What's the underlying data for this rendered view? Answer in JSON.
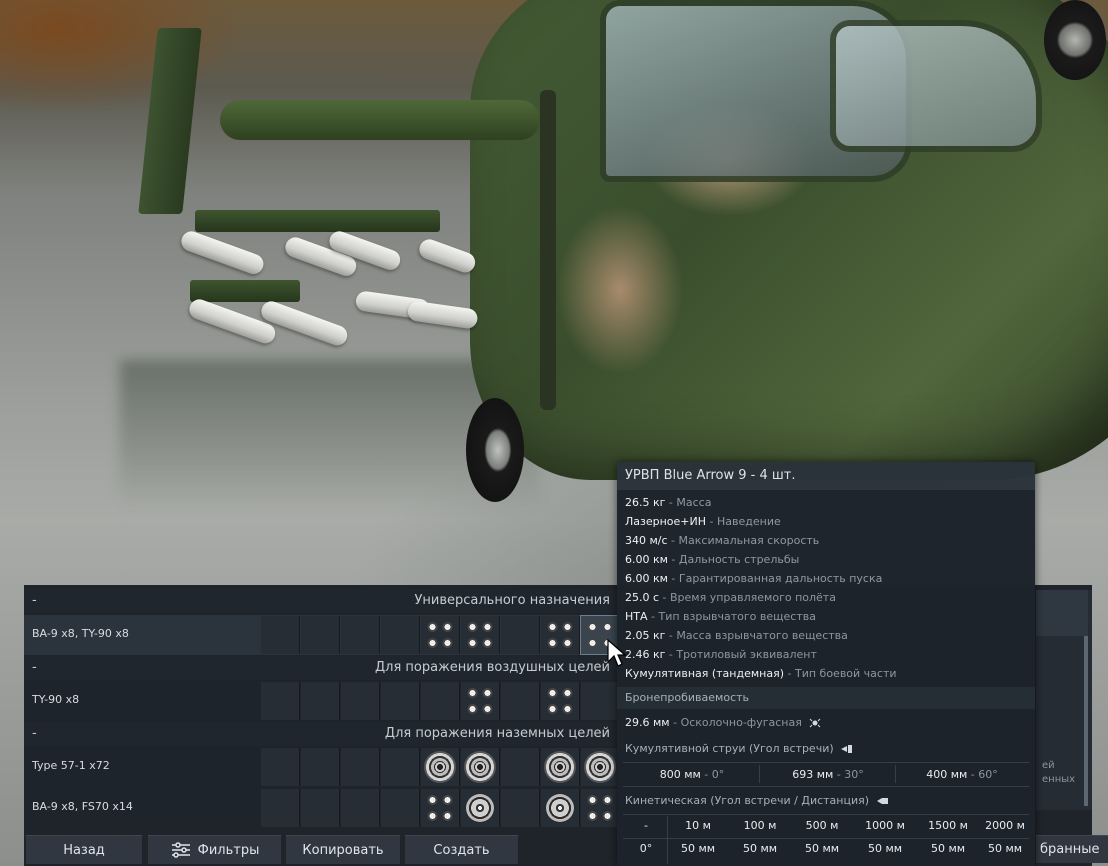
{
  "loadout": {
    "groups": [
      {
        "dash": "-",
        "title": "Универсального назначения"
      },
      {
        "dash": "-",
        "title": "Для поражения воздушных целей"
      },
      {
        "dash": "-",
        "title": "Для поражения наземных целей"
      }
    ],
    "rows": [
      {
        "name": "BA-9 x8,  TY-90 x8"
      },
      {
        "name": "TY-90 x8"
      },
      {
        "name": "Type 57-1 x72"
      },
      {
        "name": "BA-9 x8,  FS70 x14"
      }
    ]
  },
  "side_panel": {
    "text1": "ей",
    "text2": "енных"
  },
  "buttons": {
    "back": "Назад",
    "filters": "Фильтры",
    "copy": "Копировать",
    "create": "Создать",
    "selected": "бранные"
  },
  "tooltip": {
    "title": "УРВП Blue Arrow 9 - 4 шт.",
    "stats": [
      {
        "value": "26.5 кг",
        "label": "Масса"
      },
      {
        "value": "Лазерное+ИН",
        "label": "Наведение"
      },
      {
        "value": "340 м/с",
        "label": "Максимальная скорость"
      },
      {
        "value": "6.00 км",
        "label": "Дальность стрельбы"
      },
      {
        "value": "6.00 км",
        "label": "Гарантированная дальность пуска"
      },
      {
        "value": "25.0 с",
        "label": "Время управляемого полёта"
      },
      {
        "value": "НТА",
        "label": "Тип взрывчатого вещества"
      },
      {
        "value": "2.05 кг",
        "label": "Масса взрывчатого вещества"
      },
      {
        "value": "2.46 кг",
        "label": "Тротиловый эквивалент"
      },
      {
        "value": "Кумулятивная (тандемная)",
        "label": "Тип боевой части"
      }
    ],
    "armor_header": "Бронепробиваемость",
    "he_row": {
      "value": "29.6 мм",
      "label": "Осколочно-фугасная"
    },
    "cumulative_header": "Кумулятивной струи (Угол встречи)",
    "cumulative": [
      {
        "value": "800 мм",
        "angle": "0°"
      },
      {
        "value": "693 мм",
        "angle": "30°"
      },
      {
        "value": "400 мм",
        "angle": "60°"
      }
    ],
    "kinetic_header": "Кинетическая (Угол встречи / Дистанция)",
    "kinetic_table": {
      "corner": "-",
      "distances": [
        "10 м",
        "100 м",
        "500 м",
        "1000 м",
        "1500 м",
        "2000 м"
      ],
      "rows": [
        {
          "angle": "0°",
          "values": [
            "50 мм",
            "50 мм",
            "50 мм",
            "50 мм",
            "50 мм",
            "50 мм"
          ]
        }
      ]
    }
  }
}
